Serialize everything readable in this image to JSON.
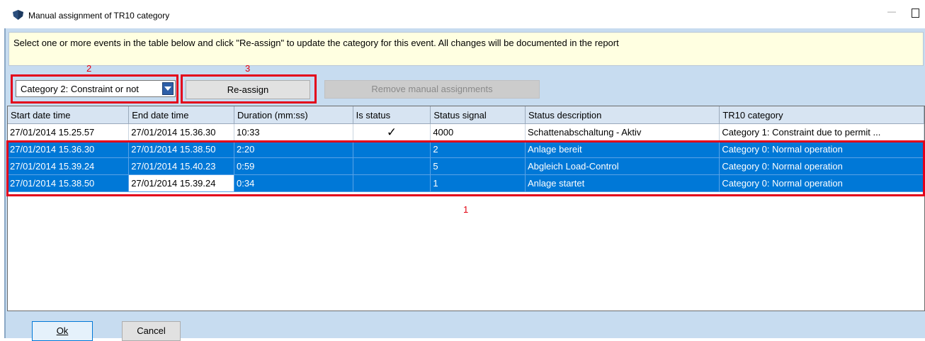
{
  "window": {
    "title": "Manual assignment of TR10 category",
    "minimize_glyph": "—"
  },
  "info": {
    "text": "Select one or more events in the table below and click \"Re-assign\" to update the category for this event. All changes will be documented in the report"
  },
  "annotations": {
    "one": "1",
    "two": "2",
    "three": "3",
    "color": "#e3000f"
  },
  "toolbar": {
    "category_value": "Category 2: Constraint or not",
    "reassign_label": "Re-assign",
    "remove_label": "Remove manual assignments"
  },
  "table": {
    "columns": [
      "Start date time",
      "End date time",
      "Duration (mm:ss)",
      "Is status",
      "Status signal",
      "Status description",
      "TR10 category"
    ],
    "rows": [
      {
        "start": "27/01/2014 15.25.57",
        "end": "27/01/2014 15.36.30",
        "duration": "10:33",
        "is_status": "✓",
        "signal": "4000",
        "description": "Schattenabschaltung - Aktiv",
        "category": "Category 1: Constraint due to permit ..."
      },
      {
        "start": "27/01/2014 15.36.30",
        "end": "27/01/2014 15.38.50",
        "duration": "2:20",
        "is_status": "",
        "signal": "2",
        "description": "Anlage bereit",
        "category": "Category 0: Normal operation"
      },
      {
        "start": "27/01/2014 15.39.24",
        "end": "27/01/2014 15.40.23",
        "duration": "0:59",
        "is_status": "",
        "signal": "5",
        "description": "Abgleich Load-Control",
        "category": "Category 0: Normal operation"
      },
      {
        "start": "27/01/2014 15.38.50",
        "end": "27/01/2014 15.39.24",
        "duration": "0:34",
        "is_status": "",
        "signal": "1",
        "description": "Anlage startet",
        "category": "Category 0: Normal operation"
      }
    ]
  },
  "footer": {
    "ok_label": "Ok",
    "cancel_label": "Cancel"
  },
  "colors": {
    "selection": "#0078d7",
    "info_background": "#ffffe1",
    "dialog_background": "#c7dcf0",
    "highlight_box": "#e3001b"
  },
  "icons": {
    "app": "app-shield-icon",
    "dropdown": "chevron-down-icon",
    "maximize": "maximize-icon",
    "minimize": "minimize-icon"
  }
}
